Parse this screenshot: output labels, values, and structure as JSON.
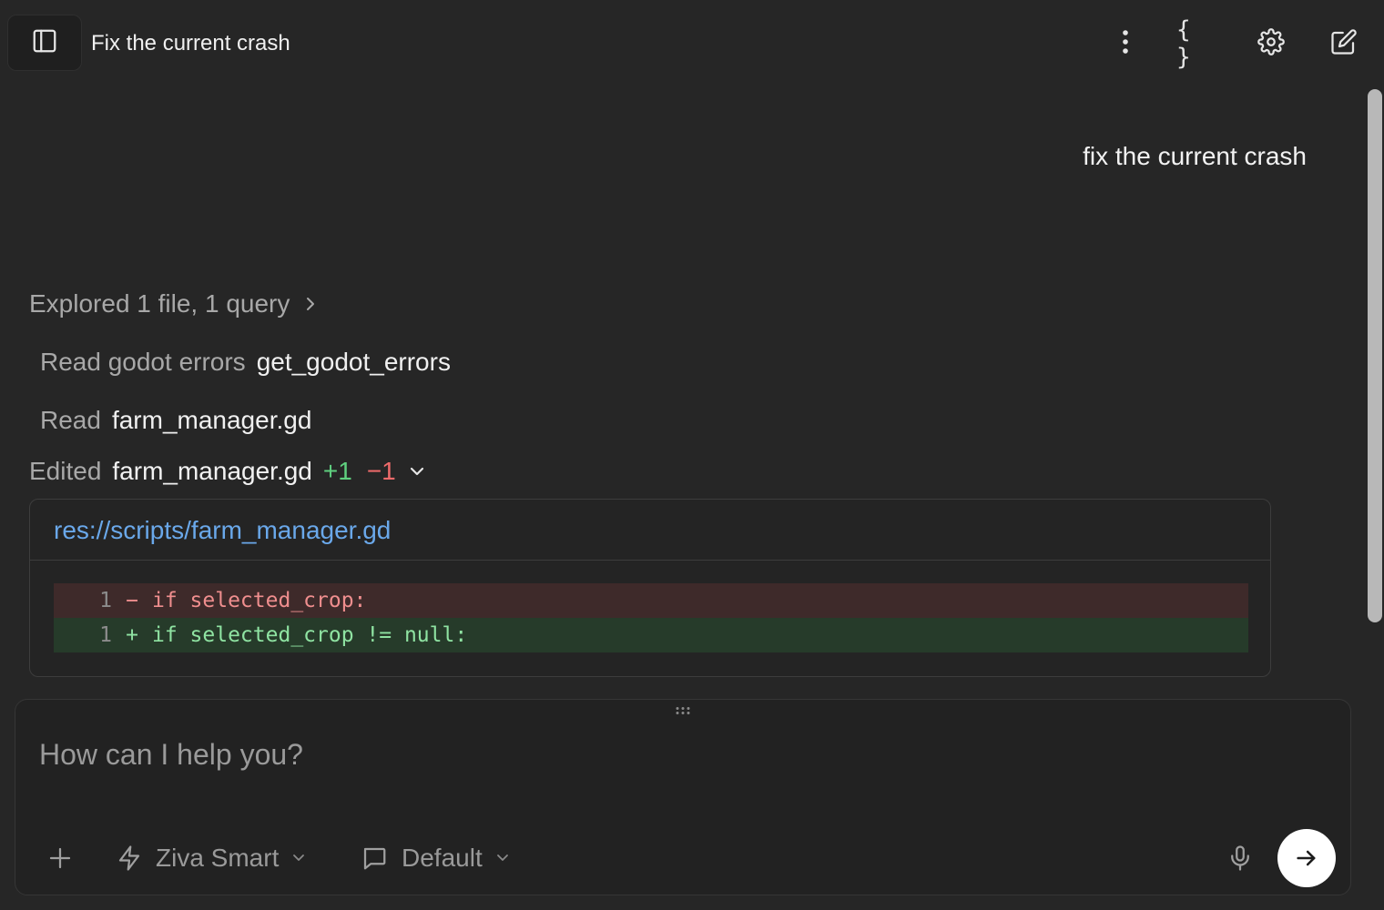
{
  "header": {
    "title": "Fix the current crash",
    "braces_glyph": "{ }"
  },
  "conversation": {
    "user_message": "fix the current crash",
    "explored_summary": "Explored 1 file, 1 query",
    "tool_calls": [
      {
        "verb": "Read godot errors",
        "object": "get_godot_errors"
      },
      {
        "verb": "Read",
        "object": "farm_manager.gd"
      }
    ],
    "edit": {
      "verb": "Edited",
      "file": "farm_manager.gd",
      "additions": "+1",
      "deletions": "−1",
      "path": "res://scripts/farm_manager.gd",
      "lines": [
        {
          "type": "del",
          "number": "1",
          "sign": "−",
          "code": "if selected_crop:"
        },
        {
          "type": "add",
          "number": "1",
          "sign": "+",
          "code": "if selected_crop != null:"
        }
      ]
    }
  },
  "composer": {
    "placeholder": "How can I help you?",
    "model_label": "Ziva Smart",
    "mode_label": "Default"
  },
  "icons": {
    "sidebar": "sidebar-icon",
    "more": "more-vertical-icon",
    "braces": "braces-icon",
    "settings": "gear-icon",
    "new_chat": "edit-icon",
    "add": "plus-icon",
    "model": "lightning-icon",
    "mode": "chat-bubble-icon",
    "mic": "microphone-icon",
    "send": "arrow-right-icon"
  }
}
